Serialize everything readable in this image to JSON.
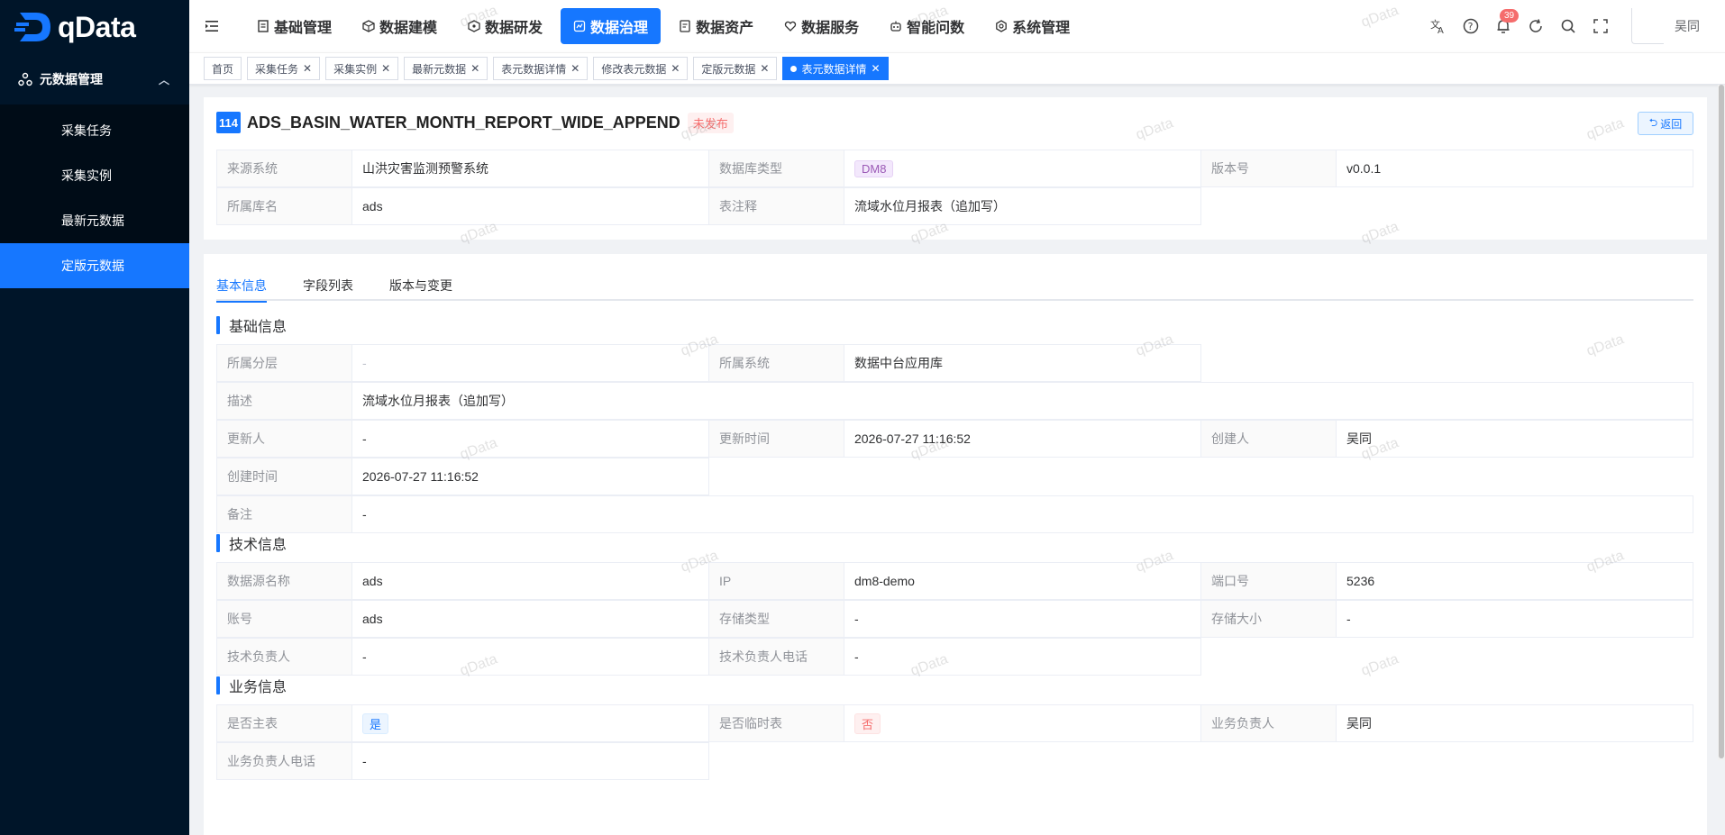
{
  "app": {
    "logo_text": "qData"
  },
  "sidebar": {
    "group_label": "元数据管理",
    "items": [
      {
        "label": "采集任务",
        "active": false
      },
      {
        "label": "采集实例",
        "active": false
      },
      {
        "label": "最新元数据",
        "active": false
      },
      {
        "label": "定版元数据",
        "active": true
      }
    ]
  },
  "topnav": {
    "items": [
      {
        "label": "基础管理"
      },
      {
        "label": "数据建模"
      },
      {
        "label": "数据研发"
      },
      {
        "label": "数据治理"
      },
      {
        "label": "数据资产"
      },
      {
        "label": "数据服务"
      },
      {
        "label": "智能问数"
      },
      {
        "label": "系统管理"
      }
    ],
    "notification_count": "39",
    "username": "吴同"
  },
  "tags": [
    {
      "label": "首页",
      "closable": false
    },
    {
      "label": "采集任务",
      "closable": true
    },
    {
      "label": "采集实例",
      "closable": true
    },
    {
      "label": "最新元数据",
      "closable": true
    },
    {
      "label": "表元数据详情",
      "closable": true
    },
    {
      "label": "修改表元数据",
      "closable": true
    },
    {
      "label": "定版元数据",
      "closable": true
    },
    {
      "label": "表元数据详情",
      "closable": true,
      "active": true
    }
  ],
  "header": {
    "id": "114",
    "table_name": "ADS_BASIN_WATER_MONTH_REPORT_WIDE_APPEND",
    "status": "未发布",
    "back_label": "返回",
    "fields": {
      "source_system": {
        "label": "来源系统",
        "value": "山洪灾害监测预警系统"
      },
      "db_type": {
        "label": "数据库类型",
        "value": "DM8"
      },
      "version": {
        "label": "版本号",
        "value": "v0.0.1"
      },
      "db_name": {
        "label": "所属库名",
        "value": "ads"
      },
      "table_comment": {
        "label": "表注释",
        "value": "流域水位月报表（追加写）"
      }
    }
  },
  "tabs": [
    {
      "label": "基本信息",
      "active": true
    },
    {
      "label": "字段列表",
      "active": false
    },
    {
      "label": "版本与变更",
      "active": false
    }
  ],
  "basic": {
    "title": "基础信息",
    "layer": {
      "label": "所属分层",
      "value": "-"
    },
    "system": {
      "label": "所属系统",
      "value": "数据中台应用库"
    },
    "desc": {
      "label": "描述",
      "value": "流域水位月报表（追加写）"
    },
    "updater": {
      "label": "更新人",
      "value": "-"
    },
    "update_time": {
      "label": "更新时间",
      "value": "2026-07-27 11:16:52"
    },
    "creator": {
      "label": "创建人",
      "value": "吴同"
    },
    "create_time": {
      "label": "创建时间",
      "value": "2026-07-27 11:16:52"
    },
    "remark": {
      "label": "备注",
      "value": "-"
    }
  },
  "tech": {
    "title": "技术信息",
    "ds_name": {
      "label": "数据源名称",
      "value": "ads"
    },
    "ip": {
      "label": "IP",
      "value": "dm8-demo"
    },
    "port": {
      "label": "端口号",
      "value": "5236"
    },
    "account": {
      "label": "账号",
      "value": "ads"
    },
    "storage_type": {
      "label": "存储类型",
      "value": "-"
    },
    "storage_size": {
      "label": "存储大小",
      "value": "-"
    },
    "tech_owner": {
      "label": "技术负责人",
      "value": "-"
    },
    "tech_phone": {
      "label": "技术负责人电话",
      "value": "-"
    }
  },
  "biz": {
    "title": "业务信息",
    "is_main": {
      "label": "是否主表",
      "value": "是"
    },
    "is_temp": {
      "label": "是否临时表",
      "value": "否"
    },
    "biz_owner": {
      "label": "业务负责人",
      "value": "吴同"
    },
    "biz_phone": {
      "label": "业务负责人电话",
      "value": "-"
    }
  },
  "watermark": "qData",
  "colors": {
    "primary": "#1677ff",
    "sidebar": "#001529",
    "danger": "#f56c6c"
  }
}
